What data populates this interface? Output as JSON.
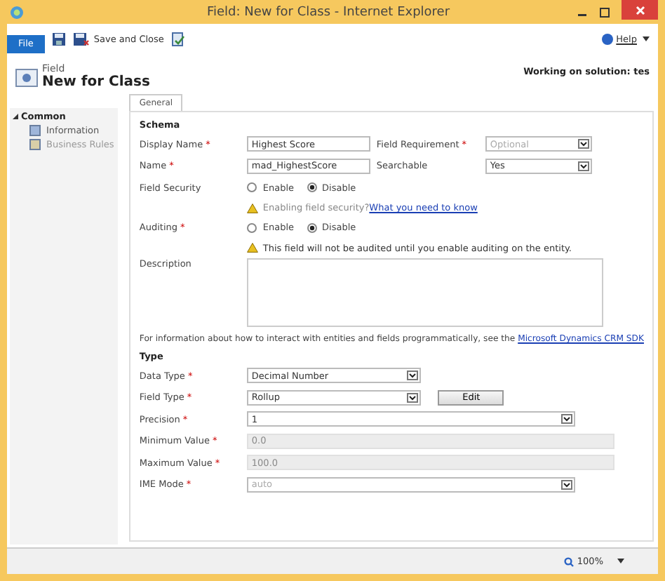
{
  "window": {
    "title": "Field: New for Class - Internet Explorer"
  },
  "ribbon": {
    "file_tab": "File",
    "save_and_close": "Save and Close",
    "help": "Help"
  },
  "header": {
    "entity": "Field",
    "title": "New for Class",
    "solution": "Working on solution: tes"
  },
  "nav": {
    "section": "Common",
    "expanded": true,
    "items": [
      {
        "label": "Information",
        "disabled": false
      },
      {
        "label": "Business Rules",
        "disabled": true
      }
    ]
  },
  "tabs": [
    {
      "label": "General",
      "selected": true
    }
  ],
  "schema": {
    "title": "Schema",
    "rows": [
      {
        "kind": "pair",
        "left": {
          "label": "Display Name",
          "required_mark": "*",
          "value": "Highest Score"
        },
        "right": {
          "label": "Field Requirement",
          "required_mark": "*",
          "value": "Optional",
          "disabled": true
        }
      },
      {
        "kind": "pair",
        "left": {
          "label": "Name",
          "required_mark": "*",
          "value": "mad_HighestScore"
        },
        "right": {
          "label": "Searchable",
          "value": "Yes",
          "disabled": false
        }
      },
      {
        "kind": "radio",
        "label": "Field Security",
        "options": [
          {
            "label": "Enable",
            "selected": false
          },
          {
            "label": "Disable",
            "selected": true
          }
        ]
      },
      {
        "kind": "note",
        "text": "Enabling field security?",
        "link": "What you need to know",
        "muted": true
      },
      {
        "kind": "radio",
        "label": "Auditing",
        "required_mark": "*",
        "options": [
          {
            "label": "Enable",
            "selected": false
          },
          {
            "label": "Disable",
            "selected": true
          }
        ]
      },
      {
        "kind": "note",
        "text": "This field will not be audited until you enable auditing on the entity.",
        "muted": false
      },
      {
        "kind": "textarea",
        "label": "Description"
      }
    ]
  },
  "info": {
    "text": "For information about how to interact with entities and fields programmatically, see the",
    "link": "Microsoft Dynamics CRM SDK"
  },
  "type": {
    "title": "Type",
    "rows": [
      {
        "kind": "short_select",
        "label": "Data Type",
        "required_mark": "*",
        "value": "Decimal Number",
        "disabled": false
      },
      {
        "kind": "short_select",
        "label": "Field Type",
        "required_mark": "*",
        "value": "Rollup",
        "disabled": false,
        "button": "Edit"
      },
      {
        "kind": "select",
        "label": "Precision",
        "required_mark": "*",
        "value": "1",
        "disabled": false
      },
      {
        "kind": "readonly",
        "label": "Minimum Value",
        "required_mark": "*",
        "value": "0.0"
      },
      {
        "kind": "readonly",
        "label": "Maximum Value",
        "required_mark": "*",
        "value": "100.0"
      },
      {
        "kind": "select",
        "label": "IME Mode",
        "required_mark": "*",
        "value": "auto",
        "disabled": true
      }
    ]
  },
  "status_bar": {
    "zoom": "100%"
  }
}
